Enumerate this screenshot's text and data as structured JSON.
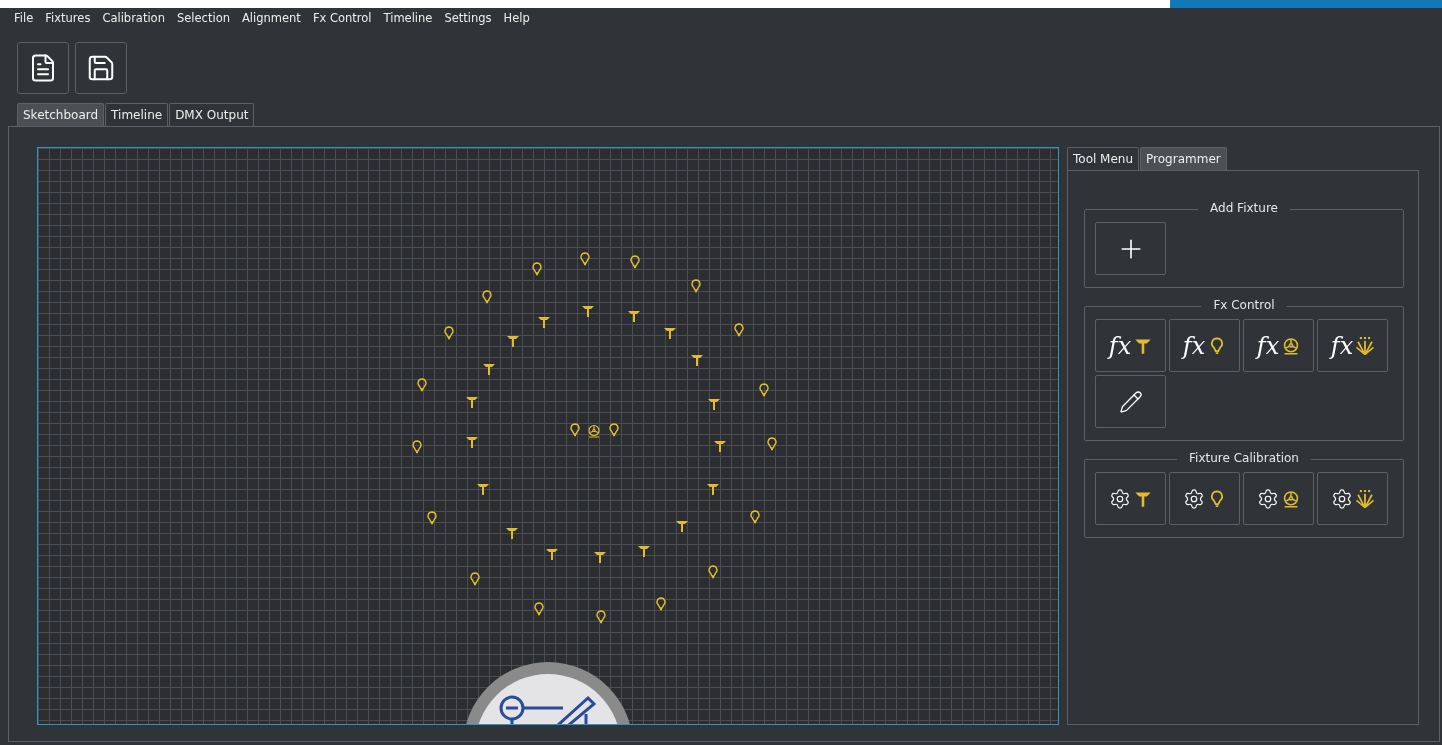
{
  "menu": [
    "File",
    "Fixtures",
    "Calibration",
    "Selection",
    "Alignment",
    "Fx Control",
    "Timeline",
    "Settings",
    "Help"
  ],
  "toolbar": [
    {
      "kind": "document"
    },
    {
      "kind": "save"
    }
  ],
  "tabs": [
    {
      "label": "Sketchboard",
      "selected": true
    },
    {
      "label": "Timeline",
      "selected": false
    },
    {
      "label": "DMX Output",
      "selected": false
    }
  ],
  "side_tabs": [
    {
      "label": "Tool Menu",
      "selected": false
    },
    {
      "label": "Programmer",
      "selected": true
    }
  ],
  "groups": [
    {
      "title": "Add Fixture",
      "buttons": [
        {
          "kind": "add"
        }
      ]
    },
    {
      "title": "Fx Control",
      "buttons": [
        {
          "kind": "fx-head",
          "label": "fx"
        },
        {
          "kind": "fx-bulb",
          "label": "fx"
        },
        {
          "kind": "fx-wheel",
          "label": "fx"
        },
        {
          "kind": "fx-sparkle",
          "label": "fx"
        },
        {
          "kind": "edit"
        }
      ]
    },
    {
      "title": "Fixture Calibration",
      "buttons": [
        {
          "kind": "cal-head"
        },
        {
          "kind": "cal-bulb"
        },
        {
          "kind": "cal-wheel"
        },
        {
          "kind": "cal-sparkle"
        }
      ]
    }
  ]
}
